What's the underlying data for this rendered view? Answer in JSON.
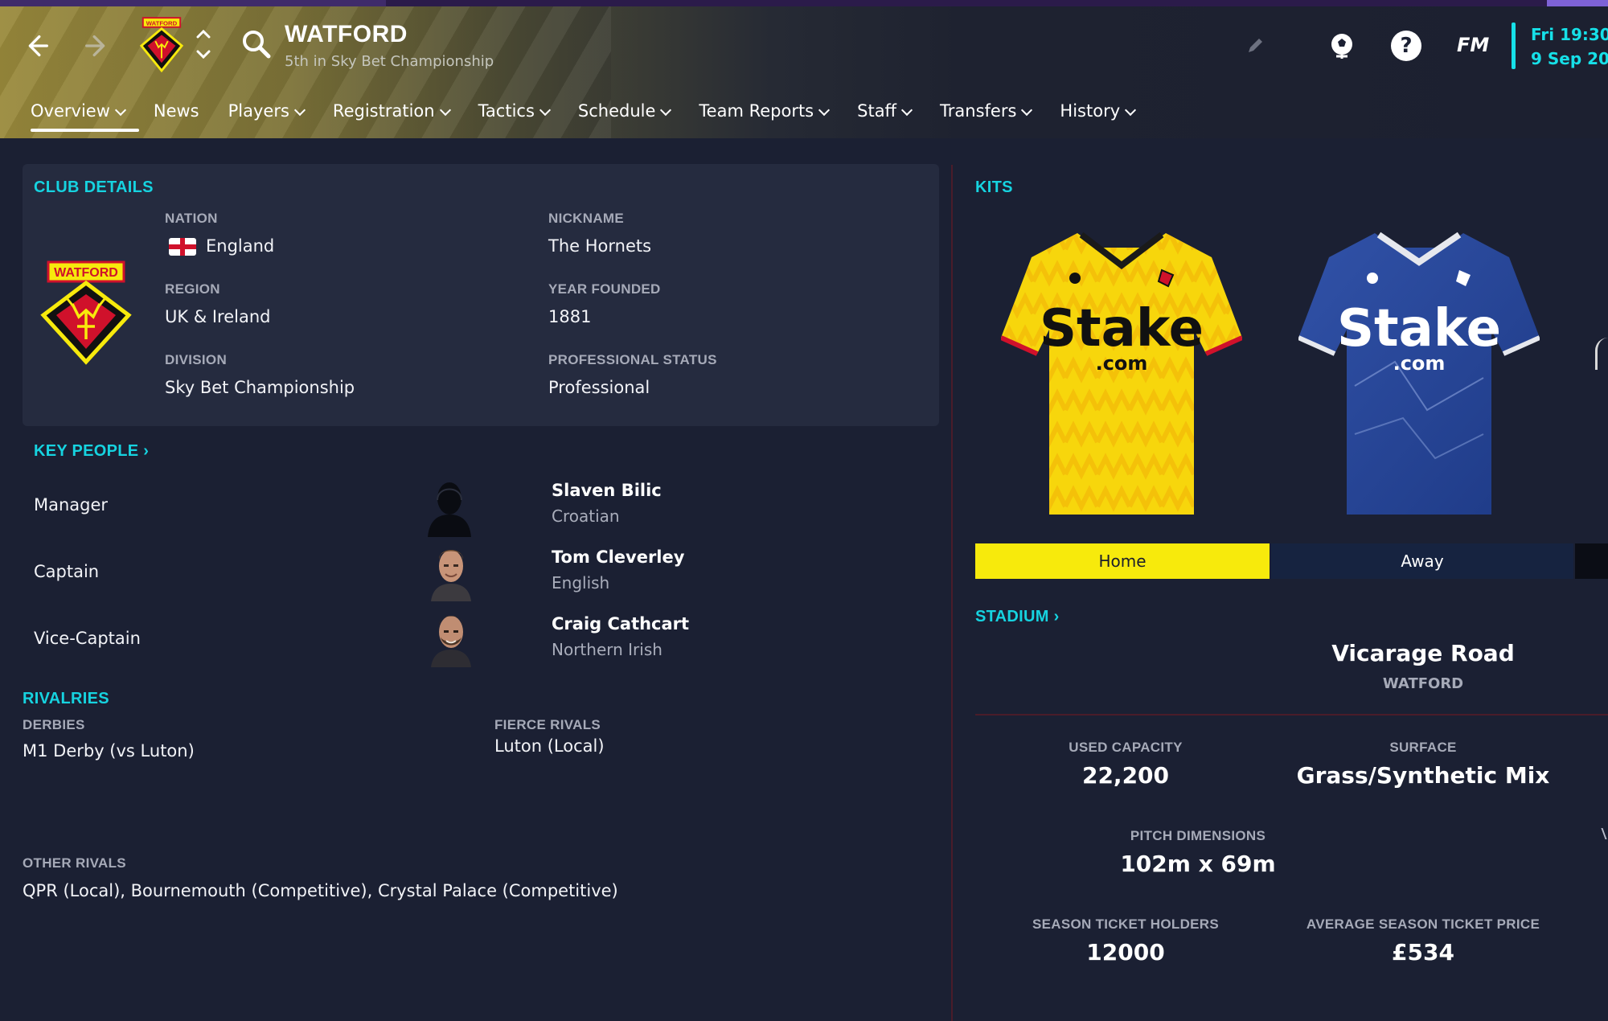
{
  "header": {
    "club_name": "WATFORD",
    "club_subtitle": "5th in Sky Bet Championship",
    "crest_text": "WATFORD",
    "brand": "FM",
    "help_glyph": "?",
    "time_line1": "Fri 19:30",
    "time_line2": "9 Sep 20",
    "colors": {
      "accent": "#16e0e8",
      "gold": "#9a8a3c"
    }
  },
  "tabs": [
    {
      "label": "Overview",
      "active": true
    },
    {
      "label": "News"
    },
    {
      "label": "Players"
    },
    {
      "label": "Registration"
    },
    {
      "label": "Tactics"
    },
    {
      "label": "Schedule"
    },
    {
      "label": "Team Reports"
    },
    {
      "label": "Staff"
    },
    {
      "label": "Transfers"
    },
    {
      "label": "History"
    }
  ],
  "club_details": {
    "title": "CLUB DETAILS",
    "crest_text": "WATFORD",
    "nation_label": "NATION",
    "nation": "England",
    "nickname_label": "NICKNAME",
    "nickname": "The Hornets",
    "region_label": "REGION",
    "region": "UK & Ireland",
    "year_label": "YEAR FOUNDED",
    "year": "1881",
    "division_label": "DIVISION",
    "division": "Sky Bet Championship",
    "status_label": "PROFESSIONAL STATUS",
    "status": "Professional"
  },
  "key_people": {
    "title": "KEY PEOPLE",
    "people": [
      {
        "role": "Manager",
        "name": "Slaven Bilic",
        "nationality": "Croatian"
      },
      {
        "role": "Captain",
        "name": "Tom Cleverley",
        "nationality": "English"
      },
      {
        "role": "Vice-Captain",
        "name": "Craig Cathcart",
        "nationality": "Northern Irish"
      }
    ]
  },
  "rivalries": {
    "title": "RIVALRIES",
    "derbies_label": "DERBIES",
    "derbies": "M1 Derby (vs Luton)",
    "fierce_label": "FIERCE RIVALS",
    "fierce": "Luton (Local)",
    "other_label": "OTHER RIVALS",
    "other": "QPR (Local), Bournemouth (Competitive), Crystal Palace (Competitive)"
  },
  "kits": {
    "title": "KITS",
    "home_label": "Home",
    "away_label": "Away",
    "sponsor_main": "Stake",
    "sponsor_sub": ".com",
    "colors": {
      "home": "#f7ea0c",
      "away": "#2a4fa0"
    }
  },
  "stadium": {
    "title": "STADIUM",
    "name": "Vicarage Road",
    "city": "WATFORD",
    "capacity_label": "USED CAPACITY",
    "capacity": "22,200",
    "surface_label": "SURFACE",
    "surface": "Grass/Synthetic Mix",
    "pitch_label": "PITCH DIMENSIONS",
    "pitch": "102m x 69m",
    "season_holders_label": "SEASON TICKET HOLDERS",
    "season_holders": "12000",
    "avg_price_label": "AVERAGE SEASON TICKET PRICE",
    "avg_price": "£534"
  }
}
